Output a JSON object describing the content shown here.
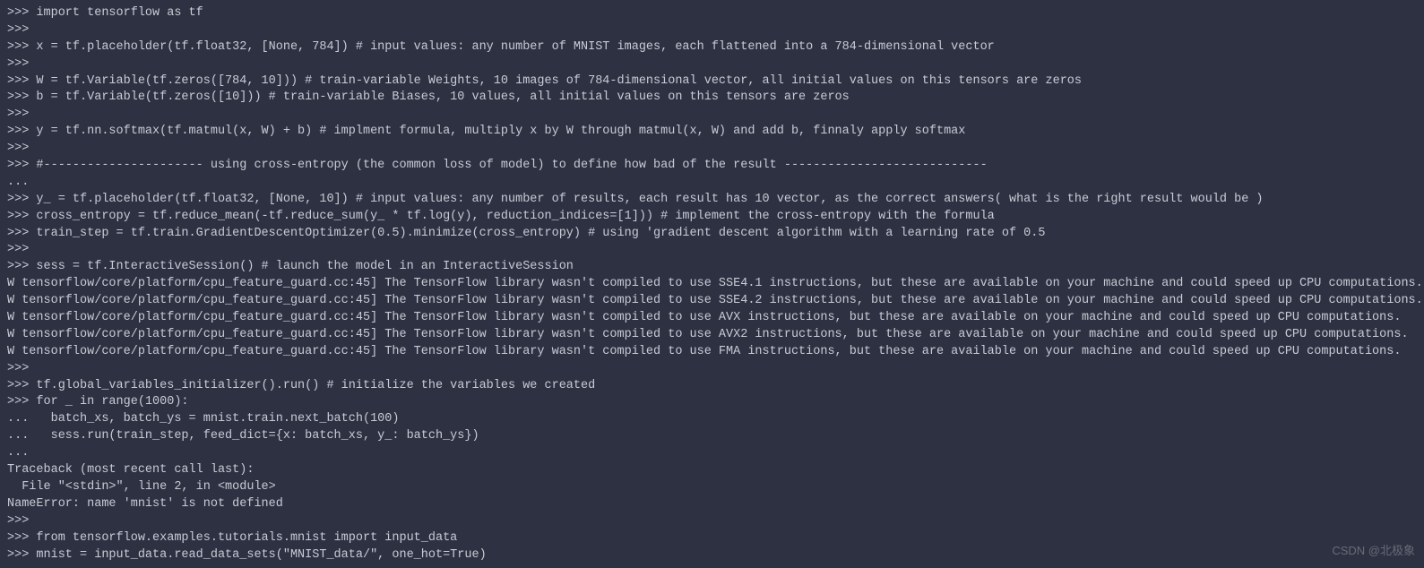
{
  "terminal": {
    "lines": [
      ">>> import tensorflow as tf",
      ">>>",
      ">>> x = tf.placeholder(tf.float32, [None, 784]) # input values: any number of MNIST images, each flattened into a 784-dimensional vector",
      ">>>",
      ">>> W = tf.Variable(tf.zeros([784, 10])) # train-variable Weights, 10 images of 784-dimensional vector, all initial values on this tensors are zeros",
      ">>> b = tf.Variable(tf.zeros([10])) # train-variable Biases, 10 values, all initial values on this tensors are zeros",
      ">>>",
      ">>> y = tf.nn.softmax(tf.matmul(x, W) + b) # implment formula, multiply x by W through matmul(x, W) and add b, finnaly apply softmax",
      ">>>",
      ">>> #---------------------- using cross-entropy (the common loss of model) to define how bad of the result ----------------------------",
      "...",
      ">>> y_ = tf.placeholder(tf.float32, [None, 10]) # input values: any number of results, each result has 10 vector, as the correct answers( what is the right result would be )",
      ">>> cross_entropy = tf.reduce_mean(-tf.reduce_sum(y_ * tf.log(y), reduction_indices=[1])) # implement the cross-entropy with the formula",
      ">>> train_step = tf.train.GradientDescentOptimizer(0.5).minimize(cross_entropy) # using 'gradient descent algorithm with a learning rate of 0.5",
      ">>>",
      ">>> sess = tf.InteractiveSession() # launch the model in an InteractiveSession",
      "W tensorflow/core/platform/cpu_feature_guard.cc:45] The TensorFlow library wasn't compiled to use SSE4.1 instructions, but these are available on your machine and could speed up CPU computations.",
      "W tensorflow/core/platform/cpu_feature_guard.cc:45] The TensorFlow library wasn't compiled to use SSE4.2 instructions, but these are available on your machine and could speed up CPU computations.",
      "W tensorflow/core/platform/cpu_feature_guard.cc:45] The TensorFlow library wasn't compiled to use AVX instructions, but these are available on your machine and could speed up CPU computations.",
      "W tensorflow/core/platform/cpu_feature_guard.cc:45] The TensorFlow library wasn't compiled to use AVX2 instructions, but these are available on your machine and could speed up CPU computations.",
      "W tensorflow/core/platform/cpu_feature_guard.cc:45] The TensorFlow library wasn't compiled to use FMA instructions, but these are available on your machine and could speed up CPU computations.",
      ">>>",
      ">>> tf.global_variables_initializer().run() # initialize the variables we created",
      ">>> for _ in range(1000):",
      "...   batch_xs, batch_ys = mnist.train.next_batch(100)",
      "...   sess.run(train_step, feed_dict={x: batch_xs, y_: batch_ys})",
      "...",
      "Traceback (most recent call last):",
      "  File \"<stdin>\", line 2, in <module>",
      "NameError: name 'mnist' is not defined",
      ">>>",
      ">>> from tensorflow.examples.tutorials.mnist import input_data",
      ">>> mnist = input_data.read_data_sets(\"MNIST_data/\", one_hot=True)"
    ]
  },
  "watermark": "CSDN @北极象"
}
